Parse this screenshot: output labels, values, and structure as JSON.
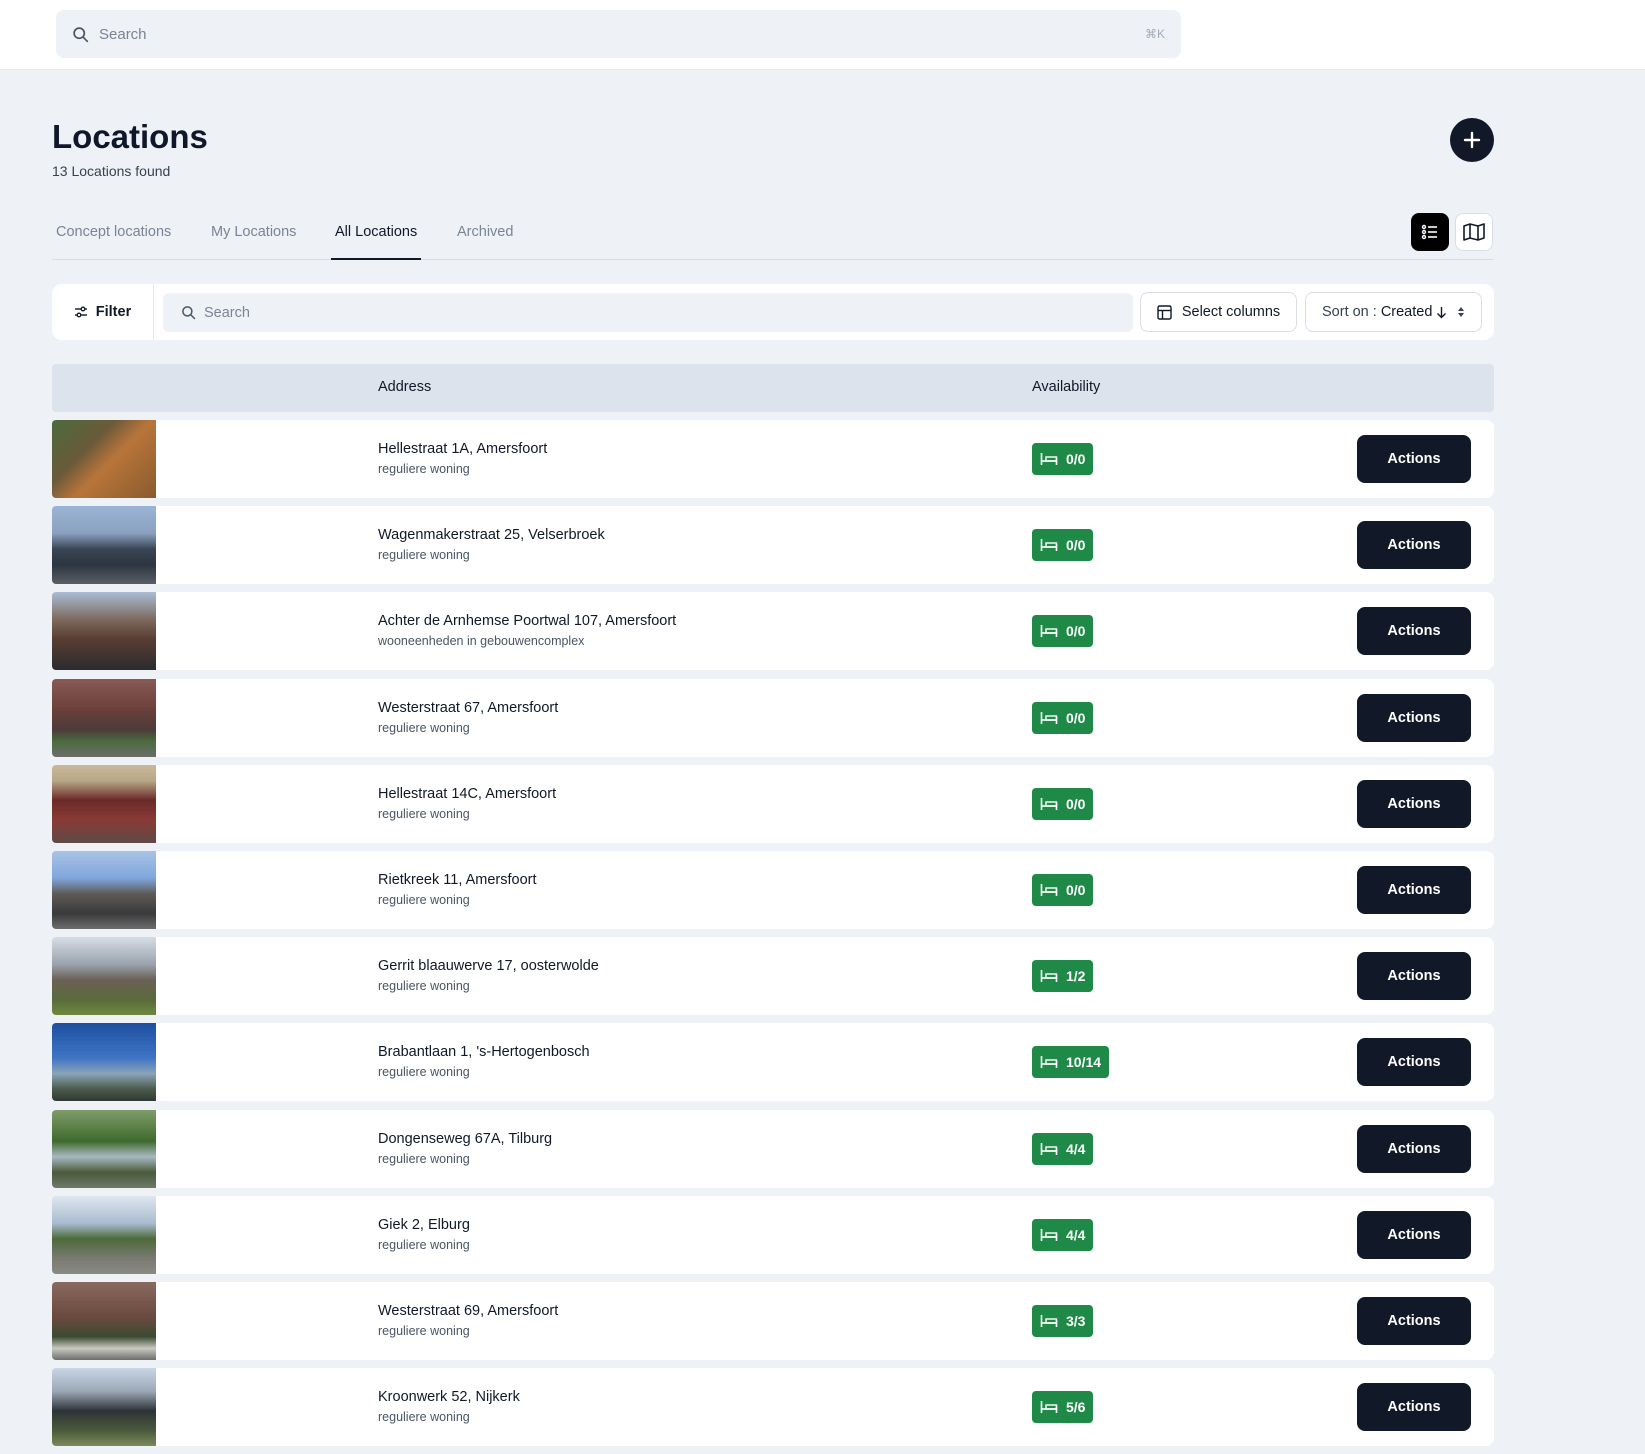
{
  "topbar": {
    "search_placeholder": "Search",
    "shortcut": "⌘K"
  },
  "header": {
    "title": "Locations",
    "count_text": "13 Locations found"
  },
  "tabs": [
    {
      "label": "Concept locations",
      "active": false
    },
    {
      "label": "My Locations",
      "active": false
    },
    {
      "label": "All Locations",
      "active": true
    },
    {
      "label": "Archived",
      "active": false
    }
  ],
  "toolbar": {
    "filter_label": "Filter",
    "search_placeholder": "Search",
    "select_columns_label": "Select columns",
    "sort_prefix": "Sort on :",
    "sort_value": "Created"
  },
  "table": {
    "columns": [
      "Address",
      "Availability"
    ],
    "action_label": "Actions",
    "rows": [
      {
        "address": "Hellestraat 1A, Amersfoort",
        "type": "reguliere woning",
        "availability": "0/0"
      },
      {
        "address": "Wagenmakerstraat 25, Velserbroek",
        "type": "reguliere woning",
        "availability": "0/0"
      },
      {
        "address": "Achter de Arnhemse Poortwal 107, Amersfoort",
        "type": "wooneenheden in gebouwencomplex",
        "availability": "0/0"
      },
      {
        "address": "Westerstraat 67, Amersfoort",
        "type": "reguliere woning",
        "availability": "0/0"
      },
      {
        "address": "Hellestraat 14C, Amersfoort",
        "type": "reguliere woning",
        "availability": "0/0"
      },
      {
        "address": "Rietkreek 11, Amersfoort",
        "type": "reguliere woning",
        "availability": "0/0"
      },
      {
        "address": "Gerrit blaauwerve 17, oosterwolde",
        "type": "reguliere woning",
        "availability": "1/2"
      },
      {
        "address": "Brabantlaan 1, 's-Hertogenbosch",
        "type": "reguliere woning",
        "availability": "10/14"
      },
      {
        "address": "Dongenseweg 67A, Tilburg",
        "type": "reguliere woning",
        "availability": "4/4"
      },
      {
        "address": "Giek 2, Elburg",
        "type": "reguliere woning",
        "availability": "4/4"
      },
      {
        "address": "Westerstraat 69, Amersfoort",
        "type": "reguliere woning",
        "availability": "3/3"
      },
      {
        "address": "Kroonwerk 52, Nijkerk",
        "type": "reguliere woning",
        "availability": "5/6"
      }
    ]
  },
  "colors": {
    "badge_green": "#1f8a47",
    "button_dark": "#111827",
    "page_bg": "#eef2f7"
  }
}
